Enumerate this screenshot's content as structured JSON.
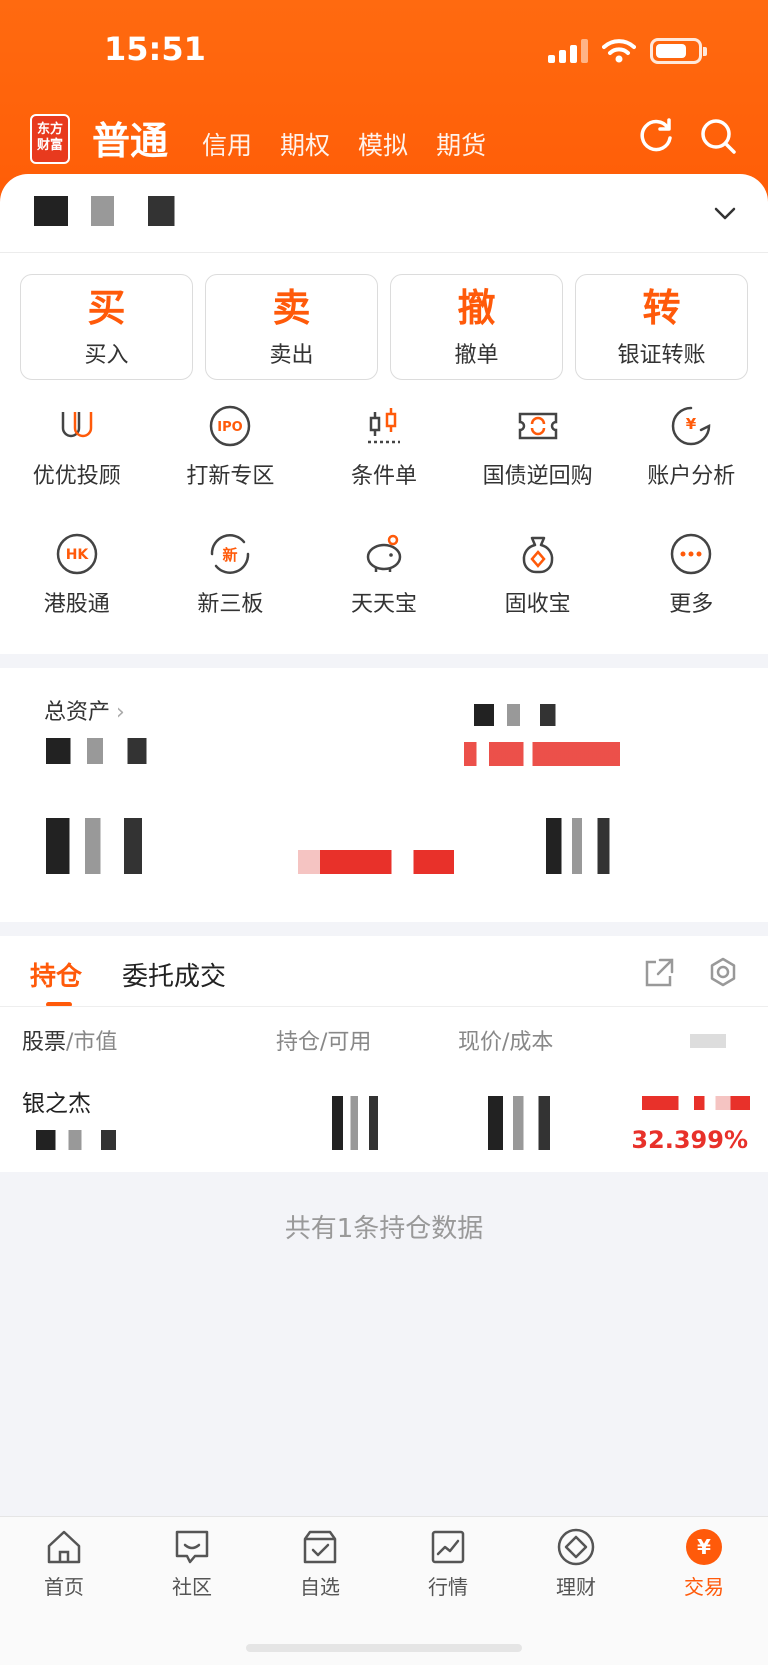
{
  "status_bar": {
    "time": "15:51"
  },
  "header": {
    "logo_text": "东方财富",
    "tabs": [
      {
        "label": "普通",
        "active": true
      },
      {
        "label": "信用"
      },
      {
        "label": "期权"
      },
      {
        "label": "模拟"
      },
      {
        "label": "期货"
      }
    ],
    "refresh_icon": "refresh-icon",
    "search_icon": "search-icon"
  },
  "actions": [
    {
      "big": "买",
      "small": "买入"
    },
    {
      "big": "卖",
      "small": "卖出"
    },
    {
      "big": "撤",
      "small": "撤单"
    },
    {
      "big": "转",
      "small": "银证转账"
    }
  ],
  "features": [
    {
      "label": "优优投顾",
      "icon": "uu-icon"
    },
    {
      "label": "打新专区",
      "icon": "ipo-icon"
    },
    {
      "label": "条件单",
      "icon": "candlestick-icon"
    },
    {
      "label": "国债逆回购",
      "icon": "ticket-icon"
    },
    {
      "label": "账户分析",
      "icon": "analysis-icon"
    },
    {
      "label": "港股通",
      "icon": "hk-icon"
    },
    {
      "label": "新三板",
      "icon": "new-board-icon"
    },
    {
      "label": "天天宝",
      "icon": "piggy-bank-icon"
    },
    {
      "label": "固收宝",
      "icon": "money-bag-icon"
    },
    {
      "label": "更多",
      "icon": "more-icon"
    }
  ],
  "assets": {
    "title": "总资产",
    "arrow": "›"
  },
  "positions": {
    "tabs": [
      {
        "label": "持仓",
        "active": true
      },
      {
        "label": "委托成交"
      }
    ],
    "columns": [
      {
        "main": "股票",
        "sub": "/市值"
      },
      {
        "main": "持仓",
        "sub": "/可用"
      },
      {
        "main": "现价",
        "sub": "/成本"
      }
    ],
    "rows": [
      {
        "name": "银之杰",
        "pct": "32.399%"
      }
    ]
  },
  "footer_text": "共有1条持仓数据",
  "bottom_nav": [
    {
      "label": "首页",
      "icon": "home-icon"
    },
    {
      "label": "社区",
      "icon": "chat-icon"
    },
    {
      "label": "自选",
      "icon": "watchlist-icon"
    },
    {
      "label": "行情",
      "icon": "market-chart-icon"
    },
    {
      "label": "理财",
      "icon": "wealth-icon"
    },
    {
      "label": "交易",
      "icon": "trade-icon",
      "active": true
    }
  ],
  "colors": {
    "brand": "#ff5a0a",
    "up": "#e8312a"
  }
}
